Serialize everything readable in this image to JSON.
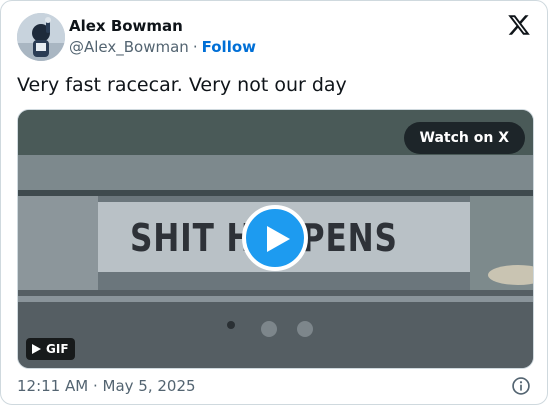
{
  "tweet": {
    "display_name": "Alex Bowman",
    "handle": "@Alex_Bowman",
    "separator": "·",
    "follow_label": "Follow",
    "text": "Very fast racecar. Very not our day",
    "timestamp": "12:11 AM · May 5, 2025"
  },
  "media": {
    "sign_text": "SHIT HAPPENS",
    "watch_label": "Watch on X",
    "gif_label": "GIF"
  },
  "icons": {
    "platform_logo": "x-logo-icon",
    "play": "play-icon",
    "info": "info-icon"
  },
  "colors": {
    "follow": "#006fd6",
    "play_button": "#1d9bf0",
    "text_primary": "#0f1419",
    "text_secondary": "#536471"
  }
}
